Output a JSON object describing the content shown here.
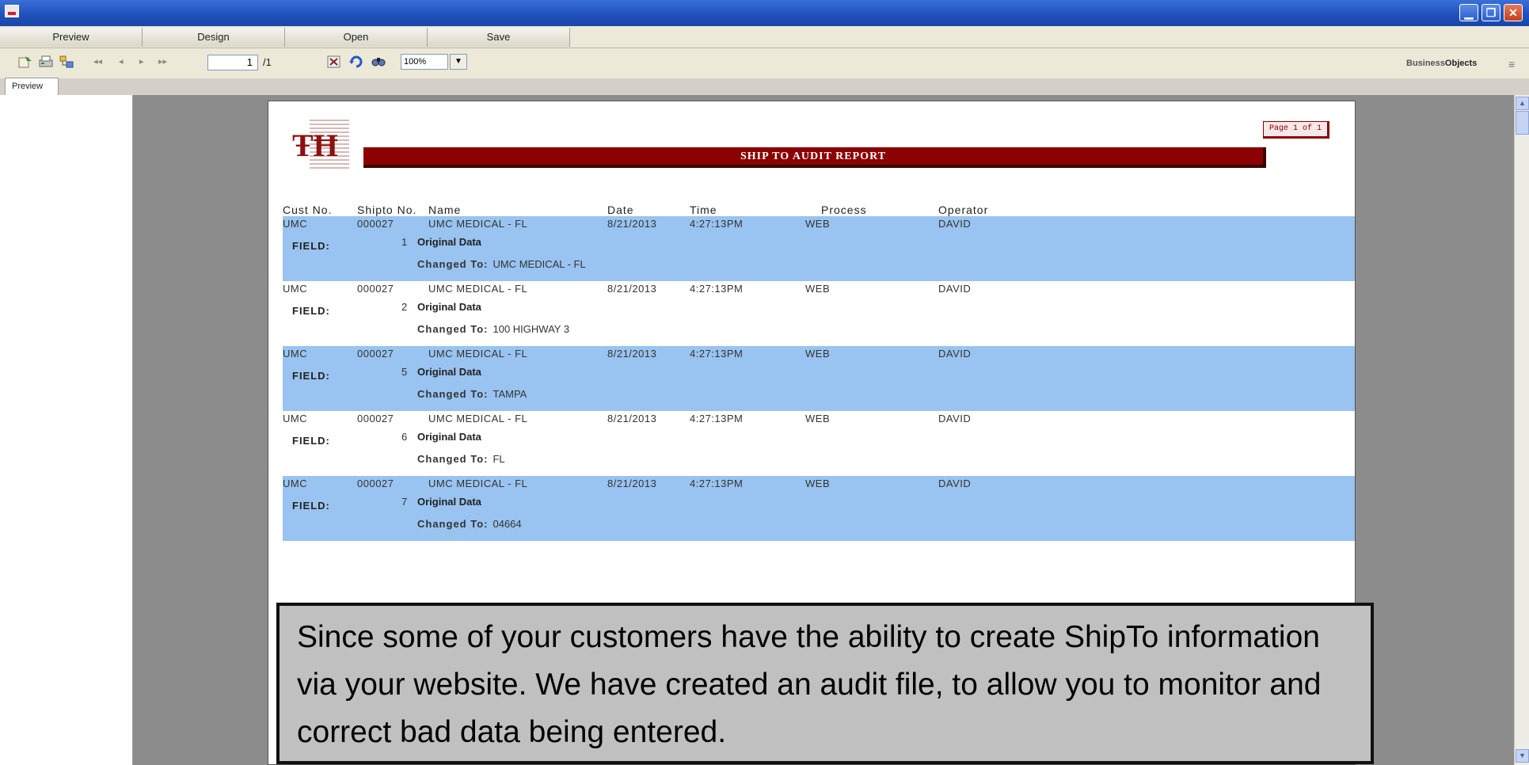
{
  "window": {
    "min_glyph": "▁",
    "max_glyph": "❐",
    "close_glyph": "✕"
  },
  "menu": {
    "items": [
      "Preview",
      "Design",
      "Open",
      "Save"
    ]
  },
  "toolbar": {
    "nav_first": "◂◂",
    "nav_prev": "◂",
    "nav_next": "▸",
    "nav_last": "▸▸",
    "current_page": "1",
    "total_pages": "/1",
    "zoom": "100%",
    "zoom_arrow": "▼",
    "brand_prefix": "Business",
    "brand_suffix": "Objects",
    "menu_glyph": "≡"
  },
  "left_tab": {
    "label": "Preview"
  },
  "scrollbar": {
    "up": "▲",
    "down": "▼"
  },
  "report": {
    "page_label": "Page 1 of 1",
    "title": "SHIP TO AUDIT REPORT",
    "headers": [
      "Cust No.",
      "Shipto No.",
      "Name",
      "Date",
      "Time",
      "Process",
      "Operator"
    ],
    "field_label": "FIELD:",
    "original_label": "Original Data",
    "changed_label": "Changed To:",
    "rows": [
      {
        "cust": "UMC",
        "shipto": "000027",
        "name": "UMC MEDICAL - FL",
        "date": "8/21/2013",
        "time": "4:27:13PM",
        "process": "WEB",
        "operator": "DAVID",
        "field": "1",
        "changed": "UMC MEDICAL - FL"
      },
      {
        "cust": "UMC",
        "shipto": "000027",
        "name": "UMC MEDICAL - FL",
        "date": "8/21/2013",
        "time": "4:27:13PM",
        "process": "WEB",
        "operator": "DAVID",
        "field": "2",
        "changed": "100 HIGHWAY 3"
      },
      {
        "cust": "UMC",
        "shipto": "000027",
        "name": "UMC MEDICAL - FL",
        "date": "8/21/2013",
        "time": "4:27:13PM",
        "process": "WEB",
        "operator": "DAVID",
        "field": "5",
        "changed": "TAMPA"
      },
      {
        "cust": "UMC",
        "shipto": "000027",
        "name": "UMC MEDICAL - FL",
        "date": "8/21/2013",
        "time": "4:27:13PM",
        "process": "WEB",
        "operator": "DAVID",
        "field": "6",
        "changed": "FL"
      },
      {
        "cust": "UMC",
        "shipto": "000027",
        "name": "UMC MEDICAL - FL",
        "date": "8/21/2013",
        "time": "4:27:13PM",
        "process": "WEB",
        "operator": "DAVID",
        "field": "7",
        "changed": "04664"
      }
    ]
  },
  "caption": "Since some of your customers have the ability to create ShipTo information via your website. We have created an audit file, to allow you to monitor and correct bad data being entered.",
  "colors": {
    "title_band": "#8b0000",
    "row_highlight": "#99c3f0",
    "titlebar": "#1f4fb8"
  }
}
